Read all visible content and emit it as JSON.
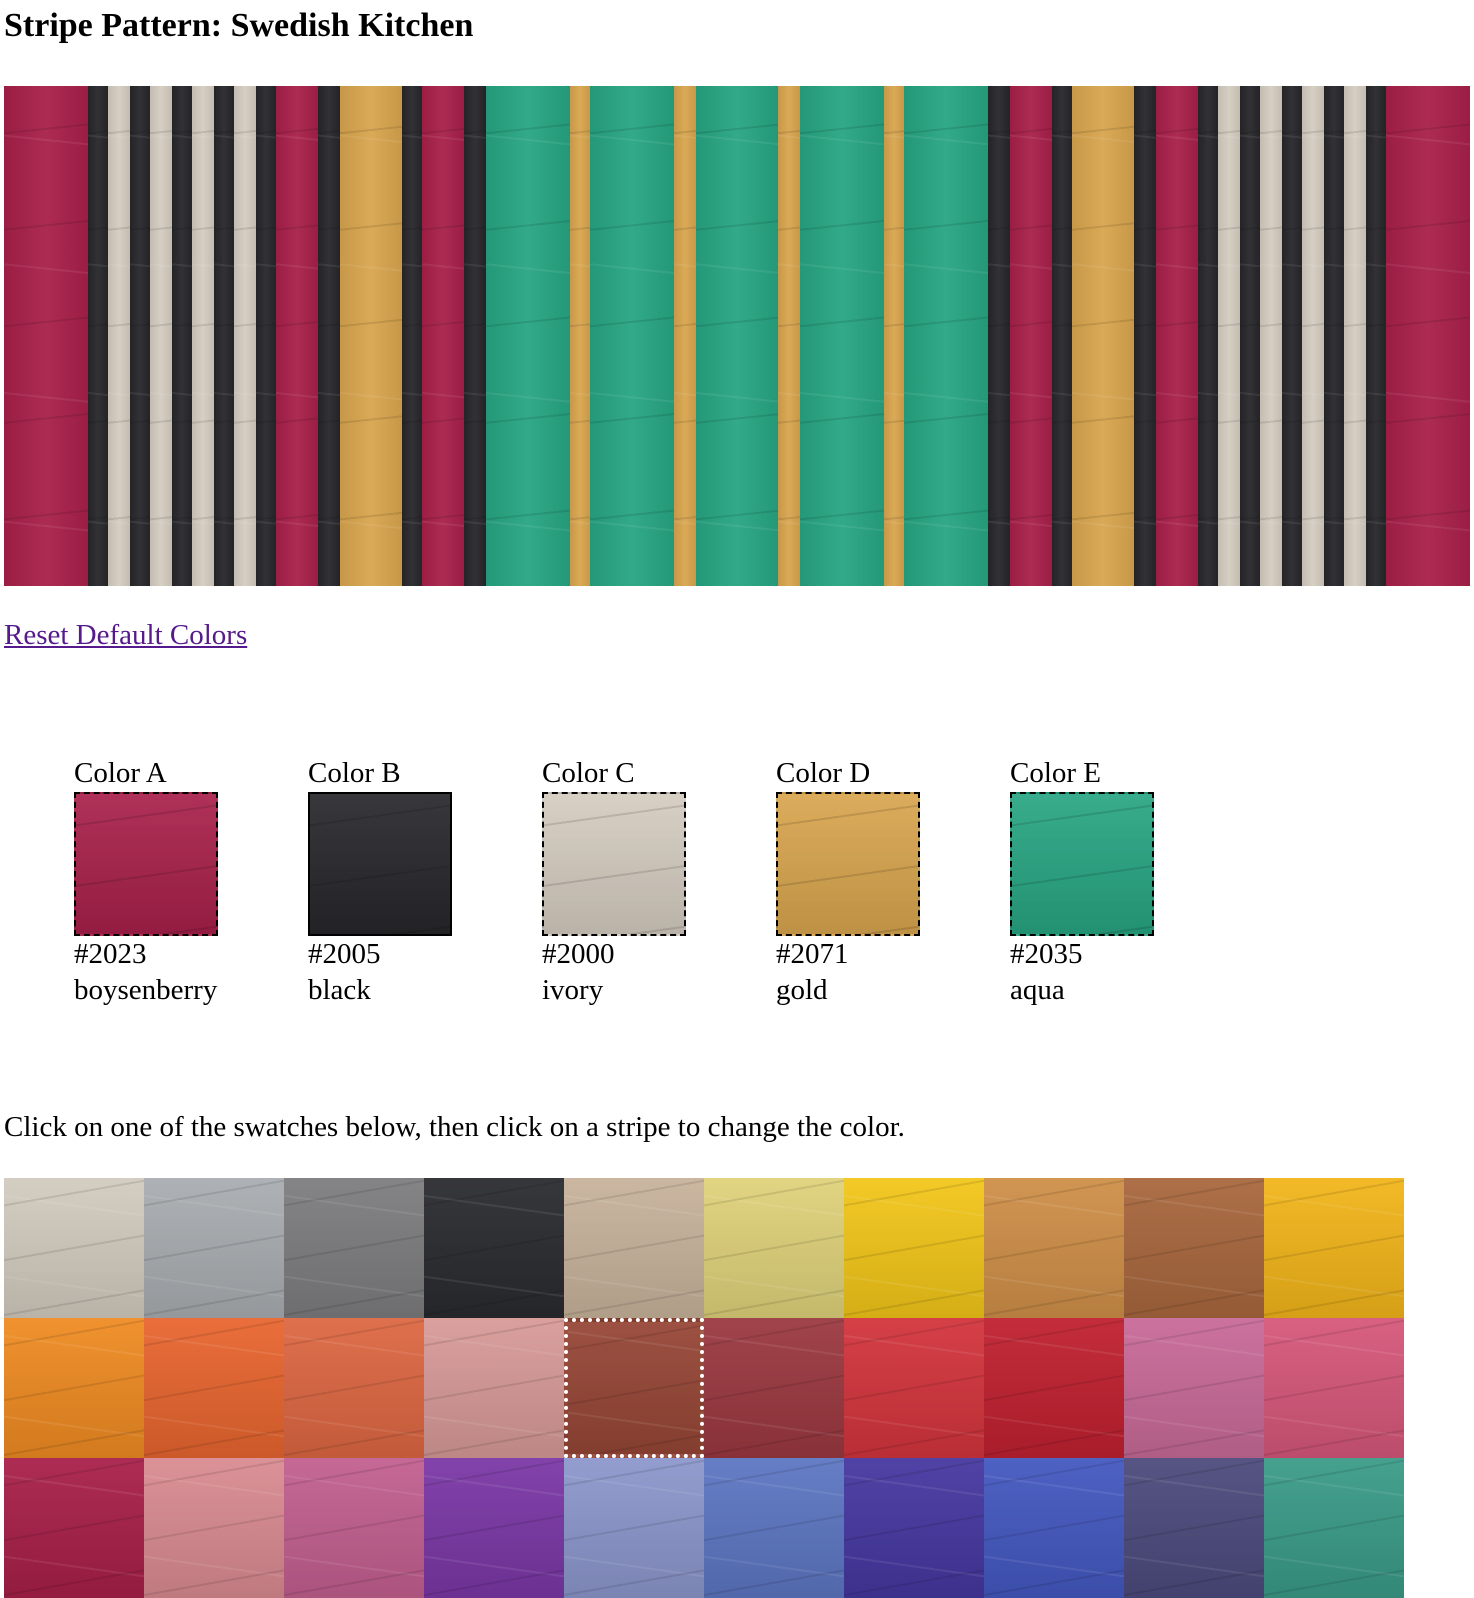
{
  "page": {
    "title": "Stripe Pattern: Swedish Kitchen",
    "reset_link": "Reset Default Colors",
    "instructions": "Click on one of the swatches below, then click on a stripe to change the color."
  },
  "colors": [
    {
      "label": "Color A",
      "code": "#2023",
      "name": "boysenberry",
      "hex": "#a8204a"
    },
    {
      "label": "Color B",
      "code": "#2005",
      "name": "black",
      "hex": "#27272b"
    },
    {
      "label": "Color C",
      "code": "#2000",
      "name": "ivory",
      "hex": "#d4ccc0"
    },
    {
      "label": "Color D",
      "code": "#2071",
      "name": "gold",
      "hex": "#d8a54e"
    },
    {
      "label": "Color E",
      "code": "#2035",
      "name": "aqua",
      "hex": "#27a582"
    }
  ],
  "stripes": [
    {
      "color": "A",
      "weight": 84
    },
    {
      "color": "B",
      "weight": 20
    },
    {
      "color": "C",
      "weight": 22
    },
    {
      "color": "B",
      "weight": 20
    },
    {
      "color": "C",
      "weight": 22
    },
    {
      "color": "B",
      "weight": 20
    },
    {
      "color": "C",
      "weight": 22
    },
    {
      "color": "B",
      "weight": 20
    },
    {
      "color": "C",
      "weight": 22
    },
    {
      "color": "B",
      "weight": 20
    },
    {
      "color": "A",
      "weight": 42
    },
    {
      "color": "B",
      "weight": 22
    },
    {
      "color": "D",
      "weight": 62
    },
    {
      "color": "B",
      "weight": 20
    },
    {
      "color": "A",
      "weight": 42
    },
    {
      "color": "B",
      "weight": 22
    },
    {
      "color": "E",
      "weight": 84
    },
    {
      "color": "D",
      "weight": 20
    },
    {
      "color": "E",
      "weight": 84
    },
    {
      "color": "D",
      "weight": 22
    },
    {
      "color": "E",
      "weight": 82
    },
    {
      "color": "D",
      "weight": 22
    },
    {
      "color": "E",
      "weight": 84
    },
    {
      "color": "D",
      "weight": 20
    },
    {
      "color": "E",
      "weight": 84
    },
    {
      "color": "B",
      "weight": 22
    },
    {
      "color": "A",
      "weight": 42
    },
    {
      "color": "B",
      "weight": 20
    },
    {
      "color": "D",
      "weight": 62
    },
    {
      "color": "B",
      "weight": 22
    },
    {
      "color": "A",
      "weight": 42
    },
    {
      "color": "B",
      "weight": 20
    },
    {
      "color": "C",
      "weight": 22
    },
    {
      "color": "B",
      "weight": 20
    },
    {
      "color": "C",
      "weight": 22
    },
    {
      "color": "B",
      "weight": 20
    },
    {
      "color": "C",
      "weight": 22
    },
    {
      "color": "B",
      "weight": 20
    },
    {
      "color": "C",
      "weight": 22
    },
    {
      "color": "B",
      "weight": 20
    },
    {
      "color": "A",
      "weight": 84
    }
  ],
  "palette": {
    "selected_index": 14,
    "swatches": [
      "#d2cbbf",
      "#a9adb1",
      "#7d7c7e",
      "#2a2b2f",
      "#c8b39b",
      "#dfd27a",
      "#f2c619",
      "#cf8f48",
      "#a8673d",
      "#f2b51a",
      "#ef8b22",
      "#e8652f",
      "#dd6742",
      "#d79a98",
      "#964636",
      "#9b3840",
      "#d3343c",
      "#c0202f",
      "#c86a98",
      "#d6577a",
      "#a81f49",
      "#d98b91",
      "#c25f8f",
      "#7a37a5",
      "#8c97cc",
      "#5c76c2",
      "#4537a0",
      "#4358c0",
      "#4c4a7c",
      "#3a9b88"
    ]
  }
}
